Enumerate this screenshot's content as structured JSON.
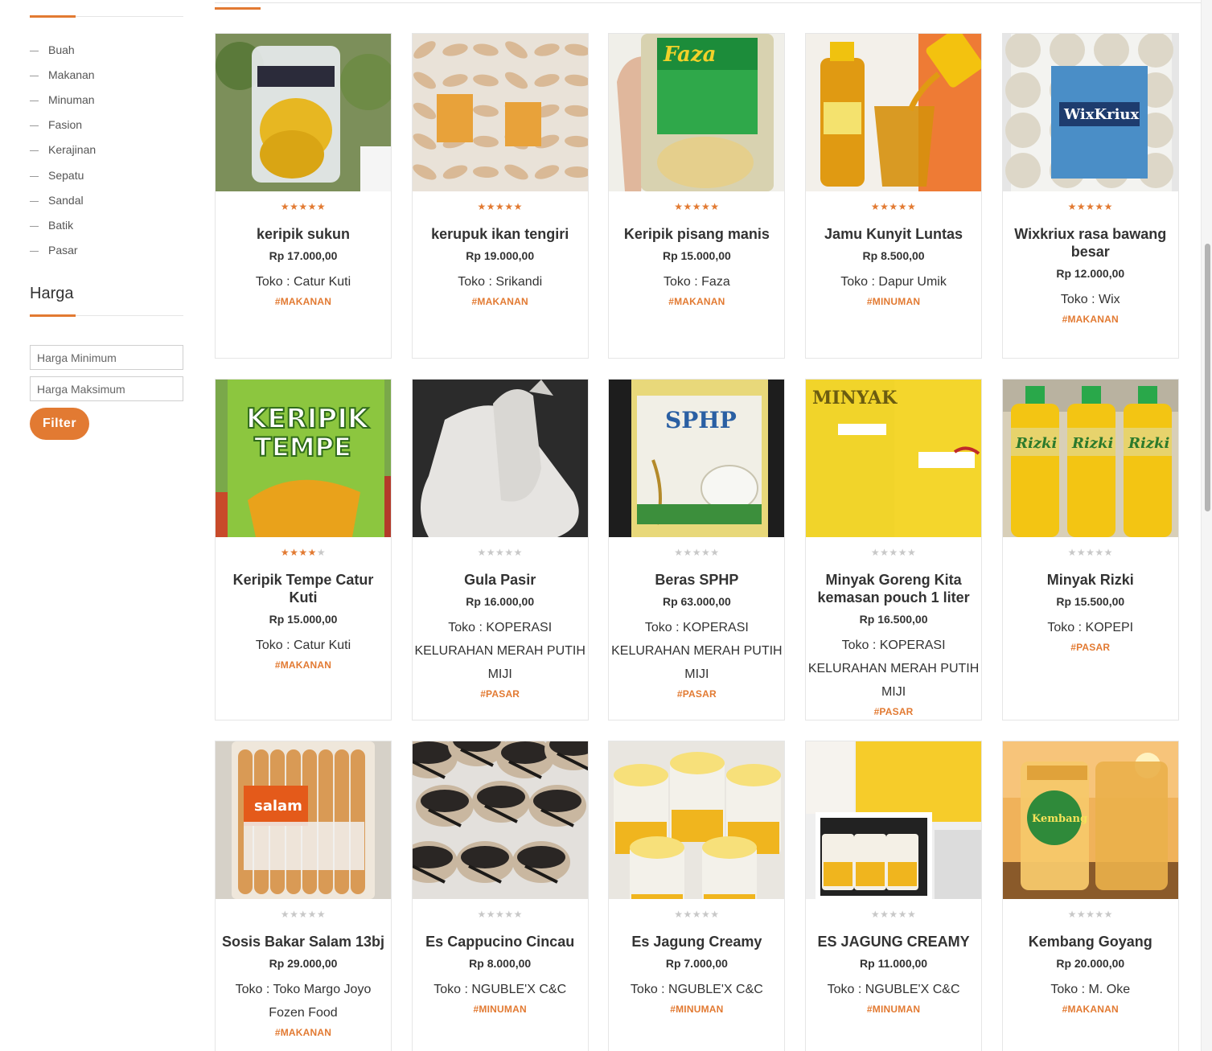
{
  "sidebar": {
    "categories": [
      "Buah",
      "Makanan",
      "Minuman",
      "Fasion",
      "Kerajinan",
      "Sepatu",
      "Sandal",
      "Batik",
      "Pasar"
    ],
    "harga_title": "Harga",
    "min_placeholder": "Harga Minimum",
    "max_placeholder": "Harga Maksimum",
    "filter_label": "Filter"
  },
  "colors": {
    "accent": "#e27a32",
    "star_off": "#c8c8c8"
  },
  "products": [
    {
      "name": "keripik sukun",
      "price": "Rp 17.000,00",
      "shop": "Toko : Catur Kuti",
      "tag": "#MAKANAN",
      "rating": 5,
      "image": "snack-bag-yellow"
    },
    {
      "name": "kerupuk ikan tengiri",
      "price": "Rp 19.000,00",
      "shop": "Toko : Srikandi",
      "tag": "#MAKANAN",
      "rating": 5,
      "image": "cracker-sticks"
    },
    {
      "name": "Keripik pisang manis",
      "price": "Rp 15.000,00",
      "shop": "Toko : Faza",
      "tag": "#MAKANAN",
      "rating": 5,
      "image": "banana-chips-bag"
    },
    {
      "name": "Jamu Kunyit Luntas",
      "price": "Rp 8.500,00",
      "shop": "Toko : Dapur Umik",
      "tag": "#MINUMAN",
      "rating": 5,
      "image": "turmeric-drink"
    },
    {
      "name": "Wixkriux rasa bawang besar",
      "price": "Rp 12.000,00",
      "shop": "Toko : Wix",
      "tag": "#MAKANAN",
      "rating": 5,
      "image": "rice-cracker-bag"
    },
    {
      "name": "Keripik Tempe Catur Kuti",
      "price": "Rp 15.000,00",
      "shop": "Toko : Catur Kuti",
      "tag": "#MAKANAN",
      "rating": 4,
      "image": "tempe-chips-bag"
    },
    {
      "name": "Gula Pasir",
      "price": "Rp 16.000,00",
      "shop": "Toko : KOPERASI KELURAHAN MERAH PUTIH MIJI",
      "tag": "#PASAR",
      "rating": 0,
      "image": "sugar-bags"
    },
    {
      "name": "Beras SPHP",
      "price": "Rp 63.000,00",
      "shop": "Toko : KOPERASI KELURAHAN MERAH PUTIH MIJI",
      "tag": "#PASAR",
      "rating": 0,
      "image": "rice-sack"
    },
    {
      "name": "Minyak Goreng Kita kemasan pouch 1 liter",
      "price": "Rp 16.500,00",
      "shop": "Toko : KOPERASI KELURAHAN MERAH PUTIH MIJI",
      "tag": "#PASAR",
      "rating": 0,
      "image": "oil-pouch"
    },
    {
      "name": "Minyak Rizki",
      "price": "Rp 15.500,00",
      "shop": "Toko : KOPEPI",
      "tag": "#PASAR",
      "rating": 0,
      "image": "oil-bottles"
    },
    {
      "name": "Sosis Bakar Salam 13bj",
      "price": "Rp 29.000,00",
      "shop": "Toko : Toko Margo Joyo Fozen Food",
      "tag": "#MAKANAN",
      "rating": 0,
      "image": "sausage-pack"
    },
    {
      "name": "Es Cappucino Cincau",
      "price": "Rp 8.000,00",
      "shop": "Toko : NGUBLE'X C&C",
      "tag": "#MINUMAN",
      "rating": 0,
      "image": "cappuccino-cups"
    },
    {
      "name": "Es Jagung Creamy",
      "price": "Rp 7.000,00",
      "shop": "Toko : NGUBLE'X C&C",
      "tag": "#MINUMAN",
      "rating": 0,
      "image": "corn-cups"
    },
    {
      "name": "ES JAGUNG CREAMY",
      "price": "Rp 11.000,00",
      "shop": "Toko : NGUBLE'X C&C",
      "tag": "#MINUMAN",
      "rating": 0,
      "image": "corn-cups-collage"
    },
    {
      "name": "Kembang Goyang",
      "price": "Rp 20.000,00",
      "shop": "Toko : M. Oke",
      "tag": "#MAKANAN",
      "rating": 0,
      "image": "snack-jars"
    }
  ]
}
